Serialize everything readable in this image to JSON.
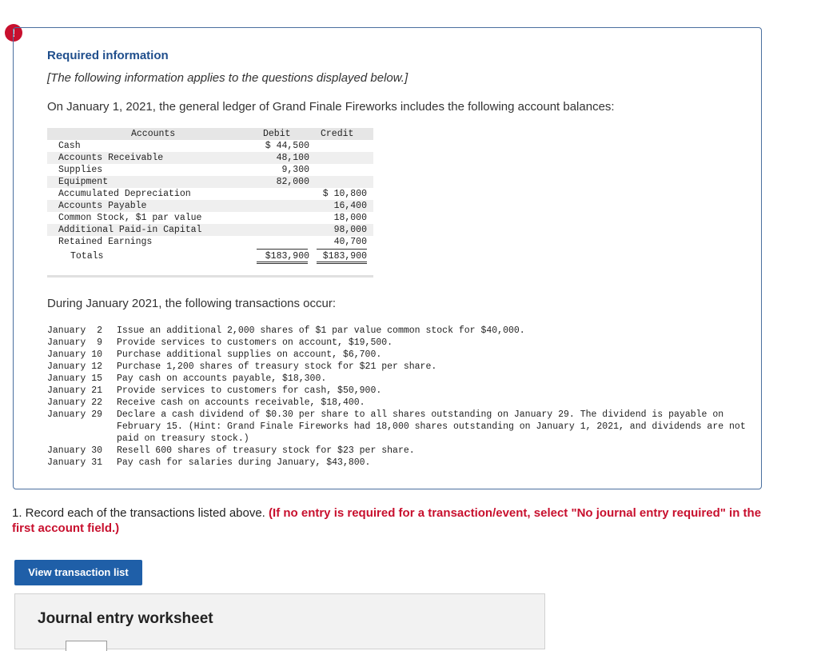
{
  "alert_icon": "!",
  "required_info": {
    "title": "Required information",
    "subtitle": "[The following information applies to the questions displayed below.]",
    "intro": "On January 1, 2021, the general ledger of Grand Finale Fireworks includes the following account balances:"
  },
  "ledger": {
    "headers": {
      "accounts": "Accounts",
      "debit": "Debit",
      "credit": "Credit"
    },
    "rows": [
      {
        "account": "Cash",
        "debit": "$ 44,500",
        "credit": ""
      },
      {
        "account": "Accounts Receivable",
        "debit": "48,100",
        "credit": ""
      },
      {
        "account": "Supplies",
        "debit": "9,300",
        "credit": ""
      },
      {
        "account": "Equipment",
        "debit": "82,000",
        "credit": ""
      },
      {
        "account": "Accumulated Depreciation",
        "debit": "",
        "credit": "$ 10,800"
      },
      {
        "account": "Accounts Payable",
        "debit": "",
        "credit": "16,400"
      },
      {
        "account": "Common Stock, $1 par value",
        "debit": "",
        "credit": "18,000"
      },
      {
        "account": "Additional Paid-in Capital",
        "debit": "",
        "credit": "98,000"
      },
      {
        "account": "Retained Earnings",
        "debit": "",
        "credit": "40,700"
      }
    ],
    "totals": {
      "label": "Totals",
      "debit": "$183,900",
      "credit": "$183,900"
    }
  },
  "during_text": "During January 2021, the following transactions occur:",
  "transactions": [
    {
      "date": "January  2",
      "text": "Issue an additional 2,000 shares of $1 par value common stock for $40,000."
    },
    {
      "date": "January  9",
      "text": "Provide services to customers on account, $19,500."
    },
    {
      "date": "January 10",
      "text": "Purchase additional supplies on account, $6,700."
    },
    {
      "date": "January 12",
      "text": "Purchase 1,200 shares of treasury stock for $21 per share."
    },
    {
      "date": "January 15",
      "text": "Pay cash on accounts payable, $18,300."
    },
    {
      "date": "January 21",
      "text": "Provide services to customers for cash, $50,900."
    },
    {
      "date": "January 22",
      "text": "Receive cash on accounts receivable, $18,400."
    },
    {
      "date": "January 29",
      "text": "Declare a cash dividend of $0.30 per share to all shares outstanding on January 29. The dividend is payable on February 15. (Hint: Grand Finale Fireworks had 18,000 shares outstanding on January 1, 2021, and dividends are not paid on treasury stock.)"
    },
    {
      "date": "January 30",
      "text": "Resell 600 shares of treasury stock for $23 per share."
    },
    {
      "date": "January 31",
      "text": "Pay cash for salaries during January, $43,800."
    }
  ],
  "question": {
    "text": "1. Record each of the transactions listed above. ",
    "instruction": "(If no entry is required for a transaction/event, select \"No journal entry required\" in the first account field.)"
  },
  "buttons": {
    "view_transaction_list": "View transaction list"
  },
  "worksheet": {
    "title": "Journal entry worksheet"
  },
  "colors": {
    "accent_blue": "#1f5fa8",
    "alert_red": "#c8102e",
    "title_blue": "#1f4e8c"
  }
}
